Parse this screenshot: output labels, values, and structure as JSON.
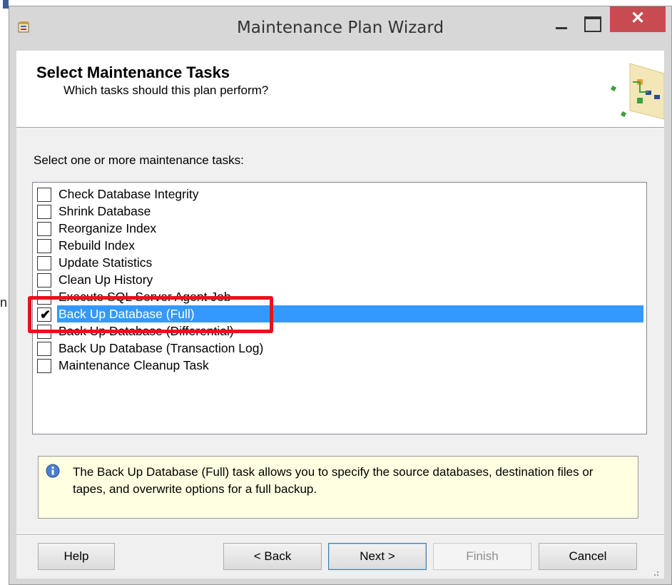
{
  "window": {
    "title": "Maintenance Plan Wizard",
    "close_glyph": "✕"
  },
  "header": {
    "title": "Select Maintenance Tasks",
    "subtitle": "Which tasks should this plan perform?"
  },
  "prompt": "Select one or more maintenance tasks:",
  "tasks": [
    {
      "label": "Check Database Integrity",
      "checked": false
    },
    {
      "label": "Shrink Database",
      "checked": false
    },
    {
      "label": "Reorganize Index",
      "checked": false
    },
    {
      "label": "Rebuild Index",
      "checked": false
    },
    {
      "label": "Update Statistics",
      "checked": false
    },
    {
      "label": "Clean Up History",
      "checked": false
    },
    {
      "label": "Execute SQL Server Agent Job",
      "checked": false
    },
    {
      "label": "Back Up Database (Full)",
      "checked": true,
      "selected": true
    },
    {
      "label": "Back Up Database (Differential)",
      "checked": false
    },
    {
      "label": "Back Up Database (Transaction Log)",
      "checked": false
    },
    {
      "label": "Maintenance Cleanup Task",
      "checked": false
    }
  ],
  "check_glyph": "✔",
  "info": {
    "text": "The Back Up Database (Full) task allows you to specify the source databases, destination files or tapes, and overwrite options for a full backup."
  },
  "buttons": {
    "help": "Help",
    "back": "< Back",
    "next": "Next >",
    "finish": "Finish",
    "cancel": "Cancel"
  },
  "colors": {
    "selection": "#3399ff",
    "highlight_box": "#e8121c",
    "info_background": "#ffffe1",
    "close_button": "#c74b50"
  },
  "background_fragment": "n"
}
